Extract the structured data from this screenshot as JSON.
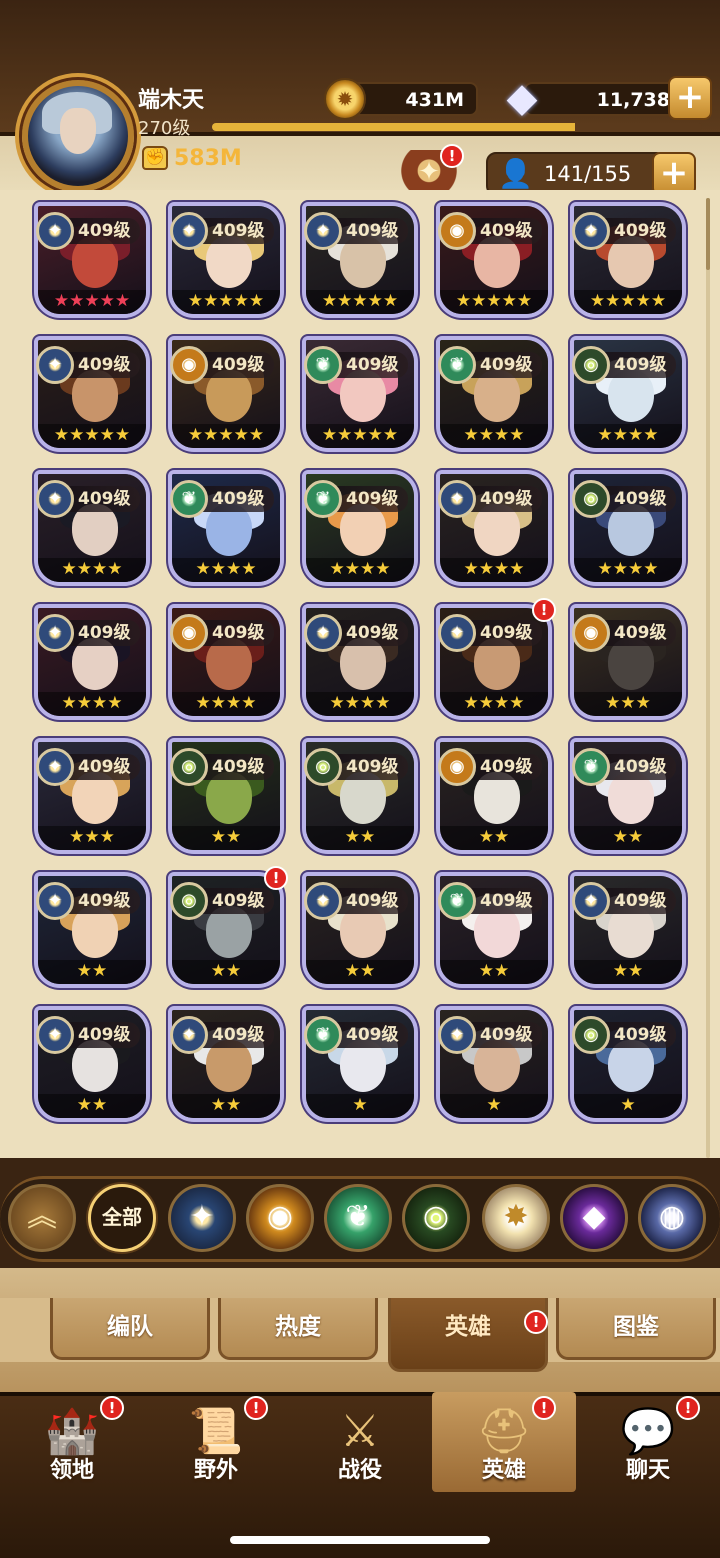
{
  "player": {
    "name": "端木天",
    "level": "270级",
    "xp_progress": 0.74,
    "power": "583M"
  },
  "resources": {
    "gold": "431M",
    "diamonds": "11,738",
    "plus": "+"
  },
  "roster": {
    "count": "141/155",
    "plus": "+"
  },
  "badge_mark": "!",
  "heroes": [
    {
      "level": "409级",
      "stars": "★★★★★",
      "star_color": "red",
      "faction": "lightbearer",
      "skin": "#c24a3a",
      "hair": "#7a1e2a",
      "bg": "#4a1e28"
    },
    {
      "level": "409级",
      "stars": "★★★★★",
      "star_color": "gold",
      "faction": "lightbearer",
      "skin": "#f1d9c6",
      "hair": "#e8c878",
      "bg": "#2a2a3a"
    },
    {
      "level": "409级",
      "stars": "★★★★★",
      "star_color": "gold",
      "faction": "lightbearer",
      "skin": "#d8c2a8",
      "hair": "#e6e2da",
      "bg": "#2a2824"
    },
    {
      "level": "409级",
      "stars": "★★★★★",
      "star_color": "gold",
      "faction": "mauler",
      "skin": "#e8b6a4",
      "hair": "#8a1e24",
      "bg": "#3a1a1a"
    },
    {
      "level": "409级",
      "stars": "★★★★★",
      "star_color": "gold",
      "faction": "lightbearer",
      "skin": "#e6c8b0",
      "hair": "#b84a2e",
      "bg": "#2a2a34"
    },
    {
      "level": "409级",
      "stars": "★★★★★",
      "star_color": "gold",
      "faction": "lightbearer",
      "skin": "#c8946a",
      "hair": "#6a3a1e",
      "bg": "#2a1e18"
    },
    {
      "level": "409级",
      "stars": "★★★★★",
      "star_color": "gold",
      "faction": "mauler",
      "skin": "#c89a5a",
      "hair": "#8a5a2a",
      "bg": "#3a2a1a"
    },
    {
      "level": "409级",
      "stars": "★★★★★",
      "star_color": "gold",
      "faction": "wilder",
      "skin": "#f2c8c0",
      "hair": "#e88aa4",
      "bg": "#3a2a34"
    },
    {
      "level": "409级",
      "stars": "★★★★",
      "star_color": "gold",
      "faction": "wilder",
      "skin": "#d8b08a",
      "hair": "#c8a25a",
      "bg": "#2a2418"
    },
    {
      "level": "409级",
      "stars": "★★★★",
      "star_color": "gold",
      "faction": "graveborn",
      "skin": "#d8e4ee",
      "hair": "#e8f0f8",
      "bg": "#2a3444"
    },
    {
      "level": "409级",
      "stars": "★★★★",
      "star_color": "gold",
      "faction": "lightbearer",
      "skin": "#e2cfc2",
      "hair": "#1a1a24",
      "bg": "#2a2028"
    },
    {
      "level": "409级",
      "stars": "★★★★",
      "star_color": "gold",
      "faction": "wilder",
      "skin": "#9ab4e6",
      "hair": "#c8d8f8",
      "bg": "#1e2a4a"
    },
    {
      "level": "409级",
      "stars": "★★★★",
      "star_color": "gold",
      "faction": "wilder",
      "skin": "#f2d0b4",
      "hair": "#e89a4a",
      "bg": "#2a3a22"
    },
    {
      "level": "409级",
      "stars": "★★★★",
      "star_color": "gold",
      "faction": "lightbearer",
      "skin": "#f0d6c2",
      "hair": "#d8c088",
      "bg": "#2a2420"
    },
    {
      "level": "409级",
      "stars": "★★★★",
      "star_color": "gold",
      "faction": "graveborn",
      "skin": "#b8c8e0",
      "hair": "#3a4a7a",
      "bg": "#1e2438"
    },
    {
      "level": "409级",
      "stars": "★★★★",
      "star_color": "gold",
      "faction": "lightbearer",
      "skin": "#e6d0c4",
      "hair": "#1a1424",
      "bg": "#3a1a22"
    },
    {
      "level": "409级",
      "stars": "★★★★",
      "star_color": "gold",
      "faction": "mauler",
      "skin": "#b86a4a",
      "hair": "#6a1e1a",
      "bg": "#3a1a16"
    },
    {
      "level": "409级",
      "stars": "★★★★",
      "star_color": "gold",
      "faction": "lightbearer",
      "skin": "#d8c0ac",
      "hair": "#3a2a22",
      "bg": "#24201e"
    },
    {
      "level": "409级",
      "stars": "★★★★",
      "star_color": "gold",
      "faction": "lightbearer",
      "skin": "#c89a74",
      "hair": "#4a2a18",
      "bg": "#2a1e16"
    },
    {
      "level": "409级",
      "stars": "★★★",
      "star_color": "gold",
      "faction": "mauler",
      "skin": "#4a4440",
      "hair": "#2a2420",
      "bg": "#3a3020"
    },
    {
      "level": "409级",
      "stars": "★★★",
      "star_color": "gold",
      "faction": "lightbearer",
      "skin": "#f2d4b8",
      "hair": "#d8a45a",
      "bg": "#2a2a3a"
    },
    {
      "level": "409级",
      "stars": "★★",
      "star_color": "gold",
      "faction": "graveborn",
      "skin": "#8aa84a",
      "hair": "#3a5a1e",
      "bg": "#24301a"
    },
    {
      "level": "409级",
      "stars": "★★",
      "star_color": "gold",
      "faction": "graveborn",
      "skin": "#d8d8cc",
      "hair": "#c8b86a",
      "bg": "#2a2c28"
    },
    {
      "level": "409级",
      "stars": "★★",
      "star_color": "gold",
      "faction": "mauler",
      "skin": "#e8e4dc",
      "hair": "#1a1a1a",
      "bg": "#2a2420"
    },
    {
      "level": "409级",
      "stars": "★★",
      "star_color": "gold",
      "faction": "wilder",
      "skin": "#f0dcd8",
      "hair": "#e8e8ee",
      "bg": "#2a2228"
    },
    {
      "level": "409级",
      "stars": "★★",
      "star_color": "gold",
      "faction": "lightbearer",
      "skin": "#f0d2b4",
      "hair": "#d8a25a",
      "bg": "#1e2638"
    },
    {
      "level": "409级",
      "stars": "★★",
      "star_color": "gold",
      "faction": "graveborn",
      "skin": "#9aa2a4",
      "hair": "#3a3c42",
      "bg": "#1e2224"
    },
    {
      "level": "409级",
      "stars": "★★",
      "star_color": "gold",
      "faction": "lightbearer",
      "skin": "#e8cab4",
      "hair": "#e8e2cc",
      "bg": "#2a2420"
    },
    {
      "level": "409级",
      "stars": "★★",
      "star_color": "gold",
      "faction": "wilder",
      "skin": "#f2d8d8",
      "hair": "#f4f0ee",
      "bg": "#2a2226"
    },
    {
      "level": "409级",
      "stars": "★★",
      "star_color": "gold",
      "faction": "lightbearer",
      "skin": "#e8dcd2",
      "hair": "#d8d4cc",
      "bg": "#2a2a2a"
    },
    {
      "level": "409级",
      "stars": "★★",
      "star_color": "gold",
      "faction": "lightbearer",
      "skin": "#e6e2e0",
      "hair": "#1a1a1e",
      "bg": "#1e1e24"
    },
    {
      "level": "409级",
      "stars": "★★",
      "star_color": "gold",
      "faction": "lightbearer",
      "skin": "#c89a6a",
      "hair": "#e8e8e8",
      "bg": "#2a241e"
    },
    {
      "level": "409级",
      "stars": "★",
      "star_color": "gold",
      "faction": "wilder",
      "skin": "#e8e8ee",
      "hair": "#c8d8e8",
      "bg": "#242a34"
    },
    {
      "level": "409级",
      "stars": "★",
      "star_color": "gold",
      "faction": "lightbearer",
      "skin": "#d8b498",
      "hair": "#c8c8c8",
      "bg": "#2a2420"
    },
    {
      "level": "409级",
      "stars": "★",
      "star_color": "gold",
      "faction": "graveborn",
      "skin": "#c8d4e8",
      "hair": "#4a6a9a",
      "bg": "#1e2230"
    }
  ],
  "hero_badges": [
    18,
    26
  ],
  "filters": {
    "all_label": "全部",
    "factions": [
      "lightbearer",
      "mauler",
      "wilder",
      "graveborn",
      "celestial",
      "hypogean",
      "dimensional"
    ]
  },
  "subtabs": [
    {
      "label": "编队",
      "active": false
    },
    {
      "label": "热度",
      "active": false
    },
    {
      "label": "英雄",
      "active": true
    },
    {
      "label": "图鉴",
      "active": false
    }
  ],
  "nav": [
    {
      "label": "领地",
      "icon": "castle-icon",
      "badge": true,
      "active": false
    },
    {
      "label": "野外",
      "icon": "map-scroll-icon",
      "badge": true,
      "active": false
    },
    {
      "label": "战役",
      "icon": "sword-shield-icon",
      "badge": false,
      "active": false
    },
    {
      "label": "英雄",
      "icon": "helmet-icon",
      "badge": true,
      "active": true
    },
    {
      "label": "聊天",
      "icon": "chat-bubble-icon",
      "badge": true,
      "active": false
    }
  ]
}
